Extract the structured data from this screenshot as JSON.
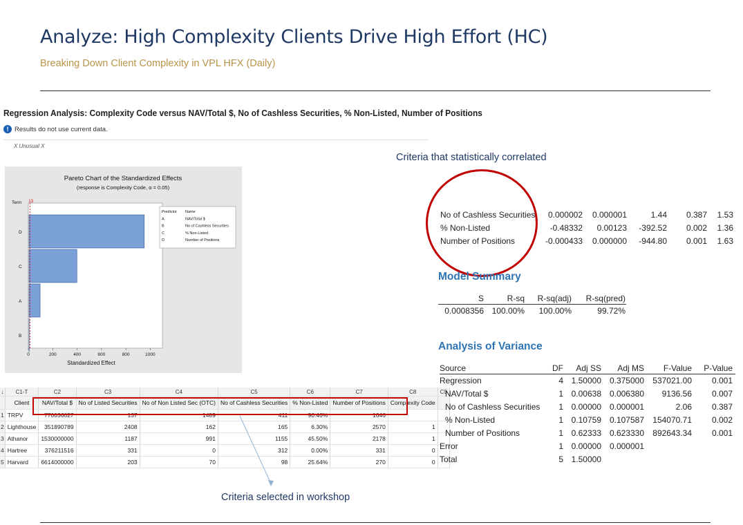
{
  "slide": {
    "title": "Analyze: High Complexity Clients Drive High Effort (HC)",
    "subtitle": "Breaking Down Client Complexity in VPL HFX (Daily)"
  },
  "regression": {
    "heading": "Regression Analysis: Complexity Code versus NAV/Total $, No of Cashless Securities, % Non-Listed, Number of Positions",
    "info": "Results do not use current data.",
    "unusual": "X Unusual X"
  },
  "chart_data": {
    "type": "bar",
    "orientation": "horizontal",
    "title": "Pareto Chart of the Standardized Effects",
    "subtitle": "(response is Complexity Code, α = 0.05)",
    "ylabel": "Term",
    "xlabel": "Standardized Effect",
    "categories": [
      "D",
      "C",
      "A",
      "B"
    ],
    "values": [
      944.8,
      392.52,
      91.0,
      1.44
    ],
    "xlim": [
      0,
      1000
    ],
    "xticks": [
      "0",
      "200",
      "400",
      "600",
      "800",
      "1000"
    ],
    "reference_value": 13,
    "reference_label": "13",
    "legend": {
      "header": [
        "Predictor",
        "Name"
      ],
      "entries": [
        [
          "A",
          "NAV/Total $"
        ],
        [
          "B",
          "No of Cashless Securities"
        ],
        [
          "C",
          "% Non-Listed"
        ],
        [
          "D",
          "Number of Positions"
        ]
      ]
    },
    "bar_color": "#7ba1d8"
  },
  "worksheet": {
    "col_numbers": [
      "C1-T",
      "C2",
      "C3",
      "C4",
      "C5",
      "C6",
      "C7",
      "C8",
      "C9"
    ],
    "col_names": [
      "Client",
      "NAV/Total $",
      "No of Listed Securities",
      "No of Non Listed Sec (OTC)",
      "No of Cashless Securities",
      "% Non-Listed",
      "Number of Positions",
      "Complexity Code",
      ""
    ],
    "rows": [
      [
        "1",
        "TRPV",
        "770036627",
        "137",
        "1489",
        "411",
        "90.46%",
        "1646",
        "",
        ""
      ],
      [
        "2",
        "Lighthouse",
        "351890789",
        "2408",
        "162",
        "165",
        "6.30%",
        "2570",
        "1",
        ""
      ],
      [
        "3",
        "Athanor",
        "1530000000",
        "1187",
        "991",
        "1155",
        "45.50%",
        "2178",
        "1",
        ""
      ],
      [
        "4",
        "Hartree",
        "376211516",
        "331",
        "0",
        "312",
        "0.00%",
        "331",
        "0",
        ""
      ],
      [
        "5",
        "Harvard",
        "6614000000",
        "203",
        "70",
        "98",
        "25.64%",
        "270",
        "0",
        ""
      ]
    ]
  },
  "captions": {
    "workshop": "Criteria selected in workshop",
    "statistical": "Criteria that statistically correlated"
  },
  "coefficients": [
    [
      "No of Cashless Securities",
      "0.000002",
      "0.000001",
      "1.44",
      "0.387",
      "1.53"
    ],
    [
      "% Non-Listed",
      "-0.48332",
      "0.00123",
      "-392.52",
      "0.002",
      "1.36"
    ],
    [
      "Number of Positions",
      "-0.000433",
      "0.000000",
      "-944.80",
      "0.001",
      "1.63"
    ]
  ],
  "model_summary": {
    "heading": "Model Summary",
    "headers": [
      "S",
      "R-sq",
      "R-sq(adj)",
      "R-sq(pred)"
    ],
    "values": [
      "0.0008356",
      "100.00%",
      "100.00%",
      "99.72%"
    ]
  },
  "anova": {
    "heading": "Analysis of Variance",
    "headers": [
      "Source",
      "DF",
      "Adj SS",
      "Adj MS",
      "F-Value",
      "P-Value"
    ],
    "rows": [
      [
        "Regression",
        "4",
        "1.50000",
        "0.375000",
        "537021.00",
        "0.001"
      ],
      [
        "NAV/Total $",
        "1",
        "0.00638",
        "0.006380",
        "9136.56",
        "0.007"
      ],
      [
        "No of Cashless Securities",
        "1",
        "0.00000",
        "0.000001",
        "2.06",
        "0.387"
      ],
      [
        "% Non-Listed",
        "1",
        "0.10759",
        "0.107587",
        "154070.71",
        "0.002"
      ],
      [
        "Number of Positions",
        "1",
        "0.62333",
        "0.623330",
        "892643.34",
        "0.001"
      ],
      [
        "Error",
        "1",
        "0.00000",
        "0.000001",
        "",
        ""
      ],
      [
        "Total",
        "5",
        "1.50000",
        "",
        "",
        ""
      ]
    ]
  }
}
